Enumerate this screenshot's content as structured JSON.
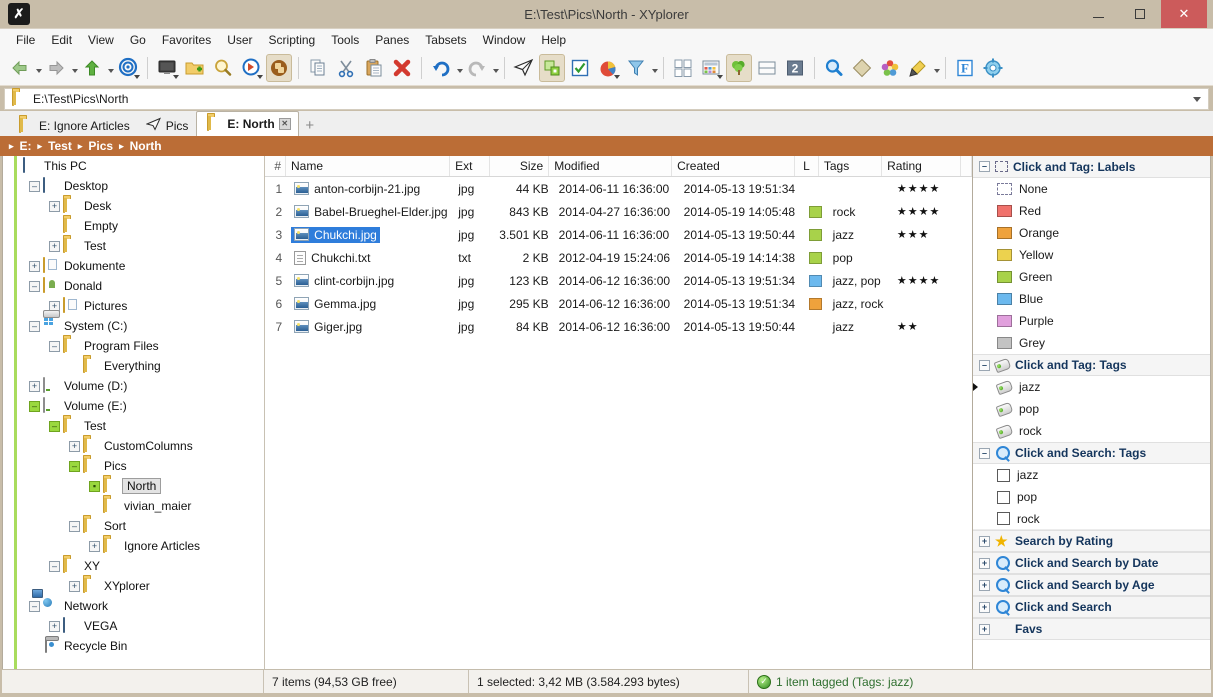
{
  "window": {
    "title": "E:\\Test\\Pics\\North - XYplorer",
    "app_icon": "xyplorer-logo-icon",
    "minimize_label": "–",
    "maximize_label": "□",
    "close_label": "✕"
  },
  "menu": {
    "items": [
      "File",
      "Edit",
      "View",
      "Go",
      "Favorites",
      "User",
      "Scripting",
      "Tools",
      "Panes",
      "Tabsets",
      "Window",
      "Help"
    ]
  },
  "toolbar": {
    "buttons": [
      {
        "name": "back-icon",
        "glyph": "◀"
      },
      {
        "name": "forward-icon",
        "glyph": "▶"
      },
      {
        "name": "up-icon",
        "glyph": "▲"
      },
      {
        "name": "target-go-icon",
        "glyph": "◎"
      },
      {
        "name": "desktop-icon",
        "glyph": "🖵"
      },
      {
        "name": "new-folder-icon",
        "glyph": "📁"
      },
      {
        "name": "find-files-icon",
        "glyph": "🔍"
      },
      {
        "name": "quick-search-icon",
        "glyph": "➤"
      },
      {
        "name": "duplicate-icon",
        "glyph": "⬤"
      },
      {
        "name": "copy-icon",
        "glyph": "❐"
      },
      {
        "name": "cut-icon",
        "glyph": "✂"
      },
      {
        "name": "paste-icon",
        "glyph": "📋"
      },
      {
        "name": "delete-icon",
        "glyph": "✖"
      },
      {
        "name": "undo-icon",
        "glyph": "↶"
      },
      {
        "name": "redo-icon",
        "glyph": "↷"
      },
      {
        "name": "send-to-icon",
        "glyph": "✈"
      },
      {
        "name": "tag-manager-icon",
        "glyph": "▣"
      },
      {
        "name": "checkbox-select-icon",
        "glyph": "☑"
      },
      {
        "name": "disk-usage-icon",
        "glyph": "◕"
      },
      {
        "name": "filter-icon",
        "glyph": "▽"
      },
      {
        "name": "thumbnails-icon",
        "glyph": "⊞"
      },
      {
        "name": "details-view-icon",
        "glyph": "▤"
      },
      {
        "name": "tree-pane-icon",
        "glyph": "🌳"
      },
      {
        "name": "split-pane-icon",
        "glyph": "▭"
      },
      {
        "name": "dual-pane-icon",
        "glyph": "2"
      },
      {
        "name": "search-icon",
        "glyph": "🔍"
      },
      {
        "name": "branch-view-icon",
        "glyph": "◈"
      },
      {
        "name": "color-filter-icon",
        "glyph": "✿"
      },
      {
        "name": "highlight-icon",
        "glyph": "🖌"
      },
      {
        "name": "font-icon",
        "glyph": "F"
      },
      {
        "name": "configuration-icon",
        "glyph": "⚙"
      }
    ]
  },
  "address": {
    "path": "E:\\Test\\Pics\\North",
    "dropdown_icon": "chevron-down-icon"
  },
  "tabs": [
    {
      "label": "E: Ignore Articles",
      "icon": "folder-icon",
      "active": false,
      "closable": false
    },
    {
      "label": "Pics",
      "icon": "paper-plane-icon",
      "active": false,
      "closable": false
    },
    {
      "label": "E: North",
      "icon": "folder-icon",
      "active": true,
      "closable": true
    }
  ],
  "tab_add_label": "+",
  "breadcrumb": {
    "items": [
      "E:",
      "Test",
      "Pics",
      "North"
    ],
    "separator": "▸"
  },
  "tree": {
    "nodes": [
      {
        "label": "This PC",
        "indent": 0,
        "toggle": "",
        "icon": "pc-icon",
        "selected": false
      },
      {
        "label": "Desktop",
        "indent": 1,
        "toggle": "–",
        "icon": "desktop-icon",
        "selected": false
      },
      {
        "label": "Desk",
        "indent": 2,
        "toggle": "+",
        "icon": "folder-icon",
        "selected": false
      },
      {
        "label": "Empty",
        "indent": 2,
        "toggle": "",
        "icon": "folder-icon",
        "selected": false
      },
      {
        "label": "Test",
        "indent": 2,
        "toggle": "+",
        "icon": "folder-icon",
        "selected": false
      },
      {
        "label": "Dokumente",
        "indent": 1,
        "toggle": "+",
        "icon": "documents-folder-icon",
        "selected": false
      },
      {
        "label": "Donald",
        "indent": 1,
        "toggle": "–",
        "icon": "user-folder-icon",
        "selected": false
      },
      {
        "label": "Pictures",
        "indent": 2,
        "toggle": "+",
        "icon": "pictures-folder-icon",
        "selected": false
      },
      {
        "label": "System (C:)",
        "indent": 1,
        "toggle": "–",
        "icon": "system-drive-icon",
        "selected": false
      },
      {
        "label": "Program Files",
        "indent": 2,
        "toggle": "–",
        "icon": "folder-icon",
        "selected": false
      },
      {
        "label": "Everything",
        "indent": 3,
        "toggle": "",
        "icon": "folder-icon",
        "selected": false
      },
      {
        "label": "Volume (D:)",
        "indent": 1,
        "toggle": "+",
        "icon": "drive-icon",
        "selected": false
      },
      {
        "label": "Volume (E:)",
        "indent": 1,
        "toggle": "–",
        "icon": "drive-icon",
        "selected": false,
        "hl": true
      },
      {
        "label": "Test",
        "indent": 2,
        "toggle": "–",
        "icon": "folder-icon",
        "selected": false,
        "hl": true
      },
      {
        "label": "CustomColumns",
        "indent": 3,
        "toggle": "+",
        "icon": "folder-icon",
        "selected": false
      },
      {
        "label": "Pics",
        "indent": 3,
        "toggle": "–",
        "icon": "folder-icon",
        "selected": false,
        "hl": true
      },
      {
        "label": "North",
        "indent": 4,
        "toggle": "▣",
        "icon": "folder-icon",
        "selected": true,
        "hl": true
      },
      {
        "label": "vivian_maier",
        "indent": 4,
        "toggle": "",
        "icon": "folder-icon",
        "selected": false
      },
      {
        "label": "Sort",
        "indent": 3,
        "toggle": "–",
        "icon": "folder-icon",
        "selected": false
      },
      {
        "label": "Ignore Articles",
        "indent": 4,
        "toggle": "+",
        "icon": "folder-icon",
        "selected": false
      },
      {
        "label": "XY",
        "indent": 2,
        "toggle": "–",
        "icon": "folder-icon",
        "selected": false
      },
      {
        "label": "XYplorer",
        "indent": 3,
        "toggle": "+",
        "icon": "folder-icon",
        "selected": false
      },
      {
        "label": "Network",
        "indent": 1,
        "toggle": "–",
        "icon": "network-icon",
        "selected": false
      },
      {
        "label": "VEGA",
        "indent": 2,
        "toggle": "+",
        "icon": "pc-icon",
        "selected": false
      },
      {
        "label": "Recycle Bin",
        "indent": 1,
        "toggle": "",
        "icon": "recycle-bin-icon",
        "selected": false
      }
    ]
  },
  "filelist": {
    "columns": [
      "#",
      "Name",
      "Ext",
      "Size",
      "Modified",
      "Created",
      "L",
      "Tags",
      "Rating"
    ],
    "rows": [
      {
        "num": "1",
        "name": "anton-corbijn-21.jpg",
        "icon": "image-file-icon",
        "ext": "jpg",
        "size": "44 KB",
        "modified": "2014-06-11 16:36:00",
        "created": "2014-05-13 19:51:34",
        "label_color": "",
        "tags": "",
        "rating": "★★★★",
        "selected": false
      },
      {
        "num": "2",
        "name": "Babel-Brueghel-Elder.jpg",
        "icon": "image-file-icon",
        "ext": "jpg",
        "size": "843 KB",
        "modified": "2014-04-27 16:36:00",
        "created": "2014-05-19 14:05:48",
        "label_color": "#a8d24a",
        "tags": "rock",
        "rating": "★★★★",
        "selected": false
      },
      {
        "num": "3",
        "name": "Chukchi.jpg",
        "icon": "image-file-icon",
        "ext": "jpg",
        "size": "3.501 KB",
        "modified": "2014-06-11 16:36:00",
        "created": "2014-05-13 19:50:44",
        "label_color": "#a8d24a",
        "tags": "jazz",
        "rating": "★★★",
        "selected": true
      },
      {
        "num": "4",
        "name": "Chukchi.txt",
        "icon": "text-file-icon",
        "ext": "txt",
        "size": "2 KB",
        "modified": "2012-04-19 15:24:06",
        "created": "2014-05-19 14:14:38",
        "label_color": "#a8d24a",
        "tags": "pop",
        "rating": "",
        "selected": false
      },
      {
        "num": "5",
        "name": "clint-corbijn.jpg",
        "icon": "image-file-icon",
        "ext": "jpg",
        "size": "123 KB",
        "modified": "2014-06-12 16:36:00",
        "created": "2014-05-13 19:51:34",
        "label_color": "#6cb9ee",
        "tags": "jazz, pop",
        "rating": "★★★★",
        "selected": false
      },
      {
        "num": "6",
        "name": "Gemma.jpg",
        "icon": "image-file-icon",
        "ext": "jpg",
        "size": "295 KB",
        "modified": "2014-06-12 16:36:00",
        "created": "2014-05-13 19:51:34",
        "label_color": "#efa23c",
        "tags": "jazz, rock",
        "rating": "",
        "selected": false
      },
      {
        "num": "7",
        "name": "Giger.jpg",
        "icon": "image-file-icon",
        "ext": "jpg",
        "size": "84 KB",
        "modified": "2014-06-12 16:36:00",
        "created": "2014-05-13 19:50:44",
        "label_color": "",
        "tags": "jazz",
        "rating": "★★",
        "selected": false
      }
    ]
  },
  "tagpanel": {
    "sections": [
      {
        "title": "Click and Tag: Labels",
        "icon": "dotted-square-icon",
        "expanded": true,
        "toggle": "–",
        "item_kind": "swatch",
        "items": [
          {
            "label": "None",
            "color": ""
          },
          {
            "label": "Red",
            "color": "#f0726c"
          },
          {
            "label": "Orange",
            "color": "#efa23c"
          },
          {
            "label": "Yellow",
            "color": "#ecd24e"
          },
          {
            "label": "Green",
            "color": "#a8d24a"
          },
          {
            "label": "Blue",
            "color": "#6cb9ee"
          },
          {
            "label": "Purple",
            "color": "#e1a0dd"
          },
          {
            "label": "Grey",
            "color": "#c3c3c3"
          }
        ]
      },
      {
        "title": "Click and Tag: Tags",
        "icon": "tag-icon",
        "expanded": true,
        "toggle": "–",
        "item_kind": "tag",
        "items": [
          {
            "label": "jazz",
            "current": true
          },
          {
            "label": "pop",
            "current": false
          },
          {
            "label": "rock",
            "current": false
          }
        ]
      },
      {
        "title": "Click and Search: Tags",
        "icon": "search-icon",
        "expanded": true,
        "toggle": "–",
        "item_kind": "checkbox",
        "items": [
          {
            "label": "jazz",
            "checked": false
          },
          {
            "label": "pop",
            "checked": false
          },
          {
            "label": "rock",
            "checked": false
          }
        ]
      },
      {
        "title": "Search by Rating",
        "icon": "star-icon",
        "expanded": false,
        "toggle": "+",
        "item_kind": "none",
        "items": []
      },
      {
        "title": "Click and Search by Date",
        "icon": "search-icon",
        "expanded": false,
        "toggle": "+",
        "item_kind": "none",
        "items": []
      },
      {
        "title": "Click and Search by Age",
        "icon": "search-icon",
        "expanded": false,
        "toggle": "+",
        "item_kind": "none",
        "items": []
      },
      {
        "title": "Click and Search",
        "icon": "search-icon",
        "expanded": false,
        "toggle": "+",
        "item_kind": "none",
        "items": []
      },
      {
        "title": "Favs",
        "icon": "",
        "expanded": false,
        "toggle": "+",
        "item_kind": "none",
        "items": []
      }
    ]
  },
  "statusbar": {
    "items_info": "7 items (94,53 GB free)",
    "selection_info": "1 selected: 3,42 MB (3.584.293 bytes)",
    "tag_info": "1 item tagged (Tags: jazz)",
    "tag_icon": "check-circle-icon"
  },
  "colors": {
    "titlebar": "#c8bda9",
    "breadcrumb": "#bb6d36",
    "selection": "#2f7ddb",
    "tree_highlight": "#9ad83e",
    "close_button": "#cc5b5b"
  }
}
